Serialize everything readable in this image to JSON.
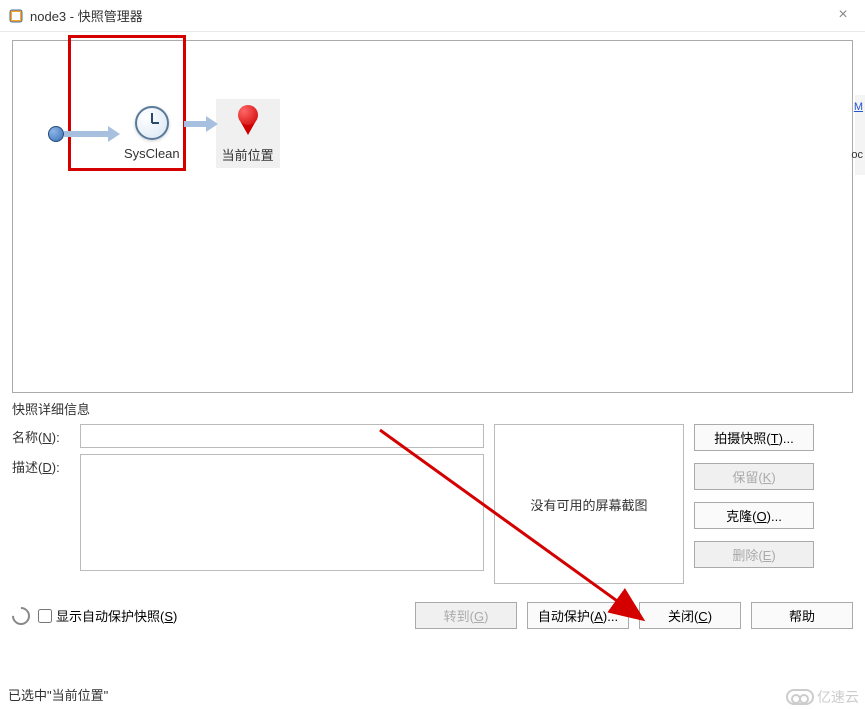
{
  "window": {
    "title": "node3 - 快照管理器"
  },
  "snapshots": {
    "sysclean_label": "SysClean",
    "current_label": "当前位置"
  },
  "detail": {
    "section_title": "快照详细信息",
    "name_label": "名称(N):",
    "desc_label": "描述(D):",
    "name_value": "",
    "desc_value": "",
    "preview_text": "没有可用的屏幕截图"
  },
  "buttons": {
    "take": "拍摄快照(T)...",
    "keep": "保留(K)",
    "clone": "克隆(O)...",
    "delete": "删除(E)",
    "goto": "转到(G)",
    "autoprotect": "自动保护(A)...",
    "close": "关闭(C)",
    "help": "帮助"
  },
  "checkbox": {
    "show_autoprotect": "显示自动保护快照(S)"
  },
  "status": {
    "text": "已选中\"当前位置\""
  },
  "watermark": {
    "text": "亿速云"
  },
  "edge": {
    "M": "M",
    "oc": "oc"
  }
}
